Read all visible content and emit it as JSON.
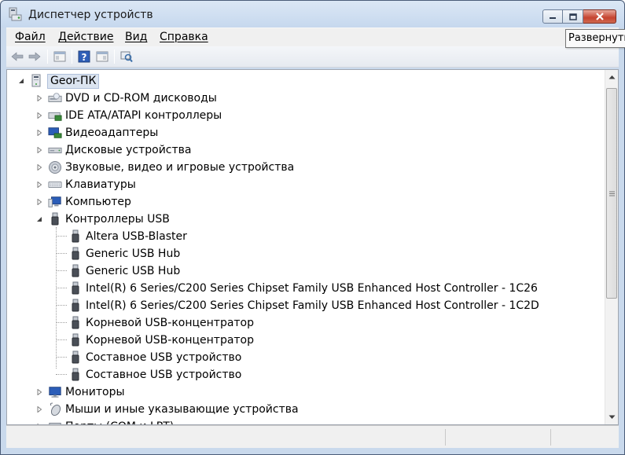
{
  "window": {
    "title": "Диспетчер устройств"
  },
  "menu": {
    "items": [
      "Файл",
      "Действие",
      "Вид",
      "Справка"
    ]
  },
  "tooltip": {
    "text": "Развернуть"
  },
  "toolbar": {
    "buttons": [
      "back-icon",
      "forward-icon",
      "properties-panel-icon",
      "help-icon",
      "details-panel-icon",
      "scan-hardware-icon"
    ]
  },
  "tree": {
    "root": "Geor-ПК",
    "categories": [
      {
        "label": "DVD и CD-ROM дисководы",
        "icon": "dvd-drive-icon",
        "expanded": false
      },
      {
        "label": "IDE ATA/ATAPI контроллеры",
        "icon": "ide-controller-icon",
        "expanded": false
      },
      {
        "label": "Видеоадаптеры",
        "icon": "display-adapter-icon",
        "expanded": false
      },
      {
        "label": "Дисковые устройства",
        "icon": "disk-drive-icon",
        "expanded": false
      },
      {
        "label": "Звуковые, видео и игровые устройства",
        "icon": "sound-device-icon",
        "expanded": false
      },
      {
        "label": "Клавиатуры",
        "icon": "keyboard-icon",
        "expanded": false
      },
      {
        "label": "Компьютер",
        "icon": "computer-icon",
        "expanded": false
      },
      {
        "label": "Контроллеры USB",
        "icon": "usb-icon",
        "expanded": true
      }
    ],
    "usb_children": [
      "Altera USB-Blaster",
      "Generic USB Hub",
      "Generic USB Hub",
      "Intel(R) 6 Series/C200 Series Chipset Family USB Enhanced Host Controller - 1C26",
      "Intel(R) 6 Series/C200 Series Chipset Family USB Enhanced Host Controller - 1C2D",
      "Корневой USB-концентратор",
      "Корневой USB-концентратор",
      "Составное USB устройство",
      "Составное USB устройство"
    ],
    "after_categories": [
      {
        "label": "Мониторы",
        "icon": "monitor-icon"
      },
      {
        "label": "Мыши и иные указывающие устройства",
        "icon": "mouse-icon"
      },
      {
        "label": "Порты (COM и LPT)",
        "icon": "port-icon"
      }
    ]
  }
}
